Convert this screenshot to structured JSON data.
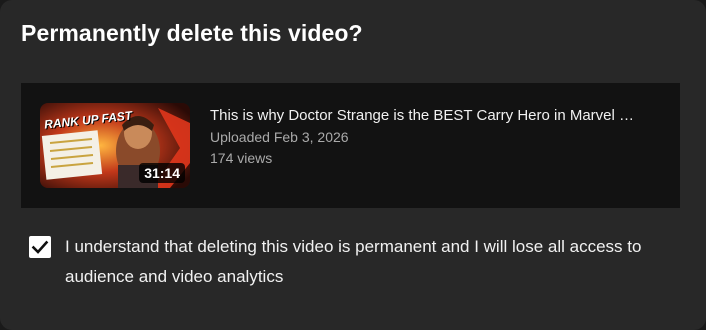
{
  "dialog": {
    "title": "Permanently delete this video?"
  },
  "video": {
    "title": "This is why Doctor Strange is the BEST Carry Hero in Marvel …",
    "uploaded": "Uploaded Feb 3, 2026",
    "views": "174 views",
    "duration": "31:14",
    "thumbnail_text": "RANK UP FAST"
  },
  "acknowledgement": {
    "checked": true,
    "label": "I understand that deleting this video is permanent and I will lose all access to audience and video analytics"
  },
  "colors": {
    "dialog_bg": "#282828",
    "card_bg": "#121212",
    "text_primary": "#f1f1f1",
    "text_secondary": "#aaaaaa"
  }
}
